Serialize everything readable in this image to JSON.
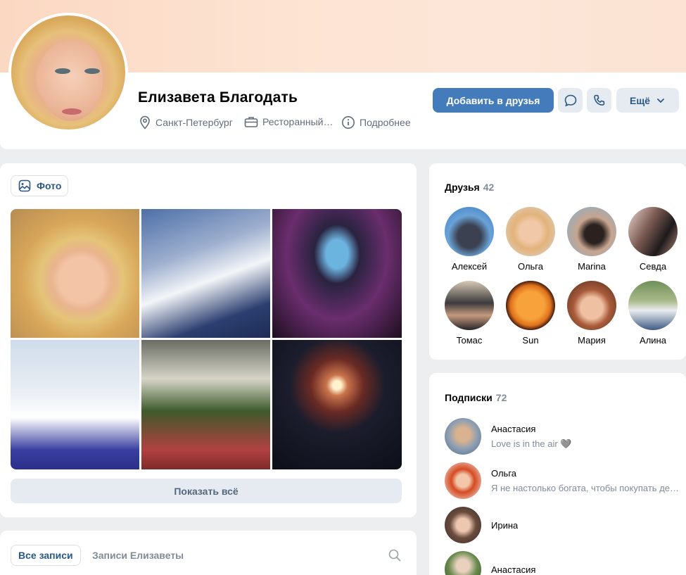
{
  "profile": {
    "name": "Елизавета Благодать",
    "city": "Санкт-Петербург",
    "work": "Ресторанный…",
    "more": "Подробнее"
  },
  "actions": {
    "add_friend": "Добавить в друзья",
    "more": "Ещё"
  },
  "photos": {
    "tag": "Фото",
    "show_all": "Показать всё"
  },
  "posts": {
    "tab_all": "Все записи",
    "tab_own": "Записи Елизаветы"
  },
  "friends": {
    "title": "Друзья",
    "count": "42",
    "items": [
      {
        "name": "Алексей"
      },
      {
        "name": "Ольга"
      },
      {
        "name": "Marina"
      },
      {
        "name": "Севда"
      },
      {
        "name": "Томас"
      },
      {
        "name": "Sun"
      },
      {
        "name": "Мария"
      },
      {
        "name": "Алина"
      }
    ]
  },
  "subscriptions": {
    "title": "Подписки",
    "count": "72",
    "items": [
      {
        "name": "Анастасия",
        "status": "Love is in the air 🩶"
      },
      {
        "name": "Ольга",
        "status": "Я не настолько богата, чтобы покупать дешевые вещи"
      },
      {
        "name": "Ирина",
        "status": ""
      },
      {
        "name": "Анастасия",
        "status": ""
      }
    ]
  },
  "colors": {
    "accent": "#447bba",
    "link": "#2a5885",
    "secondary_bg": "#e5ebf1",
    "muted_text": "#818c99"
  },
  "icons": [
    "location-icon",
    "briefcase-icon",
    "info-icon",
    "message-icon",
    "phone-icon",
    "chevron-down-icon",
    "photo-icon",
    "search-icon"
  ]
}
